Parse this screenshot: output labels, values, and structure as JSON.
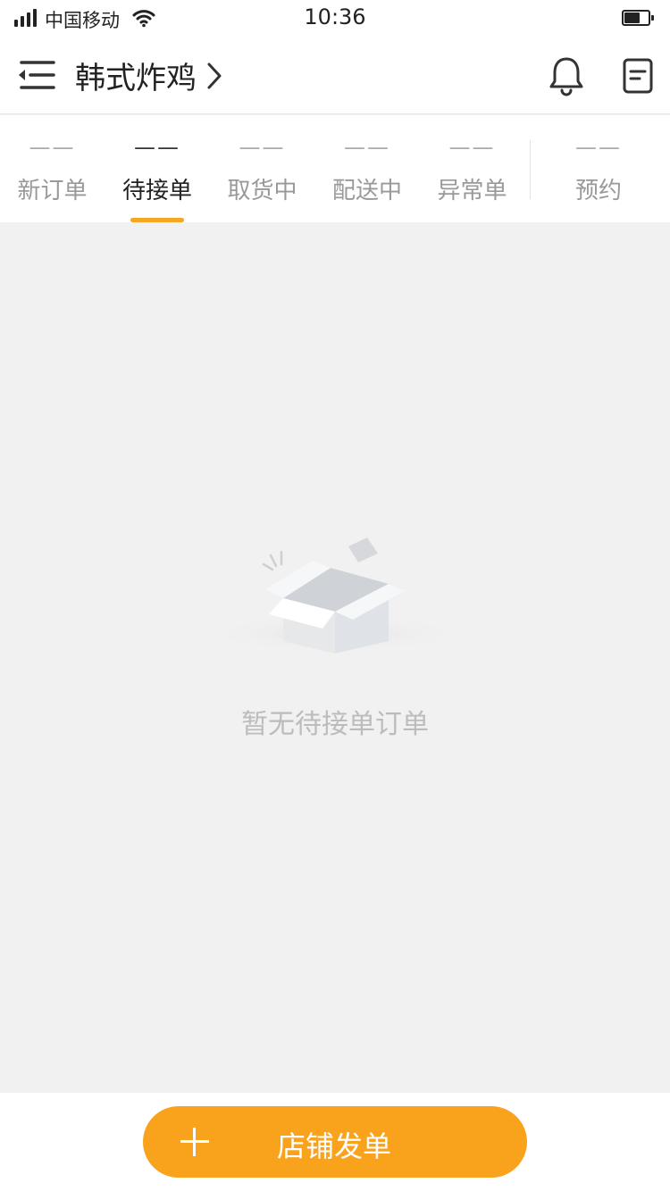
{
  "status_bar": {
    "carrier": "中国移动",
    "time": "10:36",
    "battery_level": 0.65
  },
  "header": {
    "store_name": "韩式炸鸡",
    "icons": [
      "menu-collapse-icon",
      "chevron-right-icon",
      "bell-icon",
      "order-document-icon"
    ]
  },
  "tabs": [
    {
      "count": "——",
      "label": "新订单"
    },
    {
      "count": "——",
      "label": "待接单"
    },
    {
      "count": "——",
      "label": "取货中"
    },
    {
      "count": "——",
      "label": "配送中"
    },
    {
      "count": "——",
      "label": "异常单"
    },
    {
      "count": "——",
      "label": "预约"
    }
  ],
  "active_tab": "待接单",
  "empty_state": {
    "icon": "empty-box-icon",
    "message": "暂无待接单订单"
  },
  "footer": {
    "create_label": "店铺发单",
    "icon": "plus-icon"
  },
  "colors": {
    "accent": "#f9a21c",
    "tab_underline": "#f5a623",
    "background": "#f1f1f1"
  }
}
